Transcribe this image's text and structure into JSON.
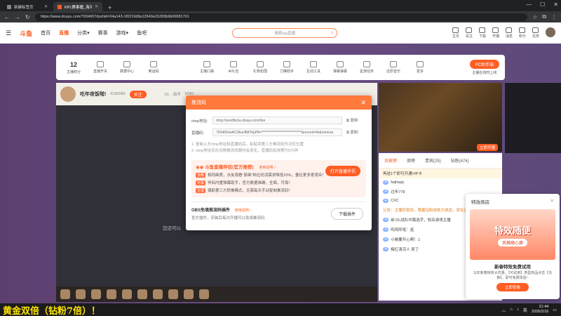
{
  "browser": {
    "tabs": [
      {
        "title": "新建标签页"
      },
      {
        "title": "KPL赛事播_海洋直播_DL - 斗鱼直播",
        "active": true
      }
    ],
    "url": "https://www.douyu.com/7934007dyshid=34a143-1f0219d9a13549a15283b9b00081701"
  },
  "header": {
    "logo": "斗鱼",
    "nav": [
      "首页",
      "直播",
      "分类",
      "赛事",
      "游戏",
      "鱼吧"
    ],
    "active_nav": "直播",
    "search_placeholder": "搜索tag直播",
    "icons": [
      "主页",
      "关注",
      "下载",
      "开播",
      "消息",
      "积分",
      "任务"
    ]
  },
  "tools": {
    "count": "12",
    "items": [
      "主播积分",
      "直播开关",
      "数据中心",
      "奥运码",
      "",
      "主播口袋",
      "AI礼包",
      "礼物包围",
      "力推助手",
      "互动工具",
      "弹幕弹幕",
      "星游任务",
      "还原音乐",
      "更多"
    ],
    "pc_button": "PC助手端",
    "pc_sub": "主播在线时上线"
  },
  "streamer": {
    "name": "吃年夜饭啦!",
    "fans": "4180085",
    "follow": "关注",
    "meta": "DL · 海洋",
    "viewers": "9240"
  },
  "video": {
    "label": "立即开播"
  },
  "placeholder_text": "您还可以",
  "modal": {
    "title": "推流码",
    "rtmp_label": "rtmp地址:",
    "rtmp_value": "rtmp://sendfw1a.douyu.com/live",
    "code_label": "直播码:",
    "code_value": "793400r/eACSfsz/8M?dyPR=*****************************&record=flv&rsmeva",
    "copy": "复制",
    "tips": [
      "1. 复制上方rtmp地址和直播码后，粘贴到第三方推流软件对应位置",
      "2. rtmp地址仅在切换推流线路时会变化，直播码有效期为5分钟"
    ],
    "promo": {
      "title": "斗鱼直播伴侣(官方推荐)",
      "link": "使用说明",
      "lines": [
        {
          "tag": "流畅",
          "text": "相同画质，水友观看\"原画\"档位码流需求降低20%，量往更多爱观众！"
        },
        {
          "tag": "可靠",
          "text": "伴侣内置弹幕助手，官方数据准确、全面，可靠！"
        },
        {
          "tag": "方便",
          "text": "偶助第三方转推模式，无需每天手动复制推流码！"
        }
      ],
      "button": "打开直播伴侣"
    },
    "obs": {
      "title": "OBS免填推流码插件",
      "link": "使用说明",
      "desc": "官方插件，安装后每次开播可以免填推流码",
      "button": "下载插件"
    }
  },
  "chat": {
    "tabs": [
      "贡献榜",
      "周榜",
      "贵宾(25)",
      "钻粉(474)"
    ],
    "messages": [
      {
        "text": "再送1个即可开通VIP卡"
      },
      {
        "text": "fwjhepp"
      },
      {
        "text": "过年778"
      },
      {
        "text": "CXC"
      },
      {
        "text": "公告：主播你喜欢，限量钻粉皮肤大放送，就在这里"
      },
      {
        "text": "前:DL战队中路选手，知名游戏主播"
      },
      {
        "text": "鸣鸣呼呕：逛"
      },
      {
        "text": "小敞要开心啊！1"
      },
      {
        "text": "梅忆清凉人 来了"
      }
    ]
  },
  "shop": {
    "title": "特效商店",
    "banner": "特效随便",
    "banner_sub": "风格随心换",
    "heading": "新春特效免费试用",
    "desc": "马年新春特效大优惠，【可试用】类型商品点击【兑换】，即可免费体验~",
    "button": "立即查看"
  },
  "taskbar": {
    "marquee": "黄金双倍（钻粉7倍）！",
    "lang": "英",
    "time": "21:44",
    "date": "2026/2/16"
  }
}
